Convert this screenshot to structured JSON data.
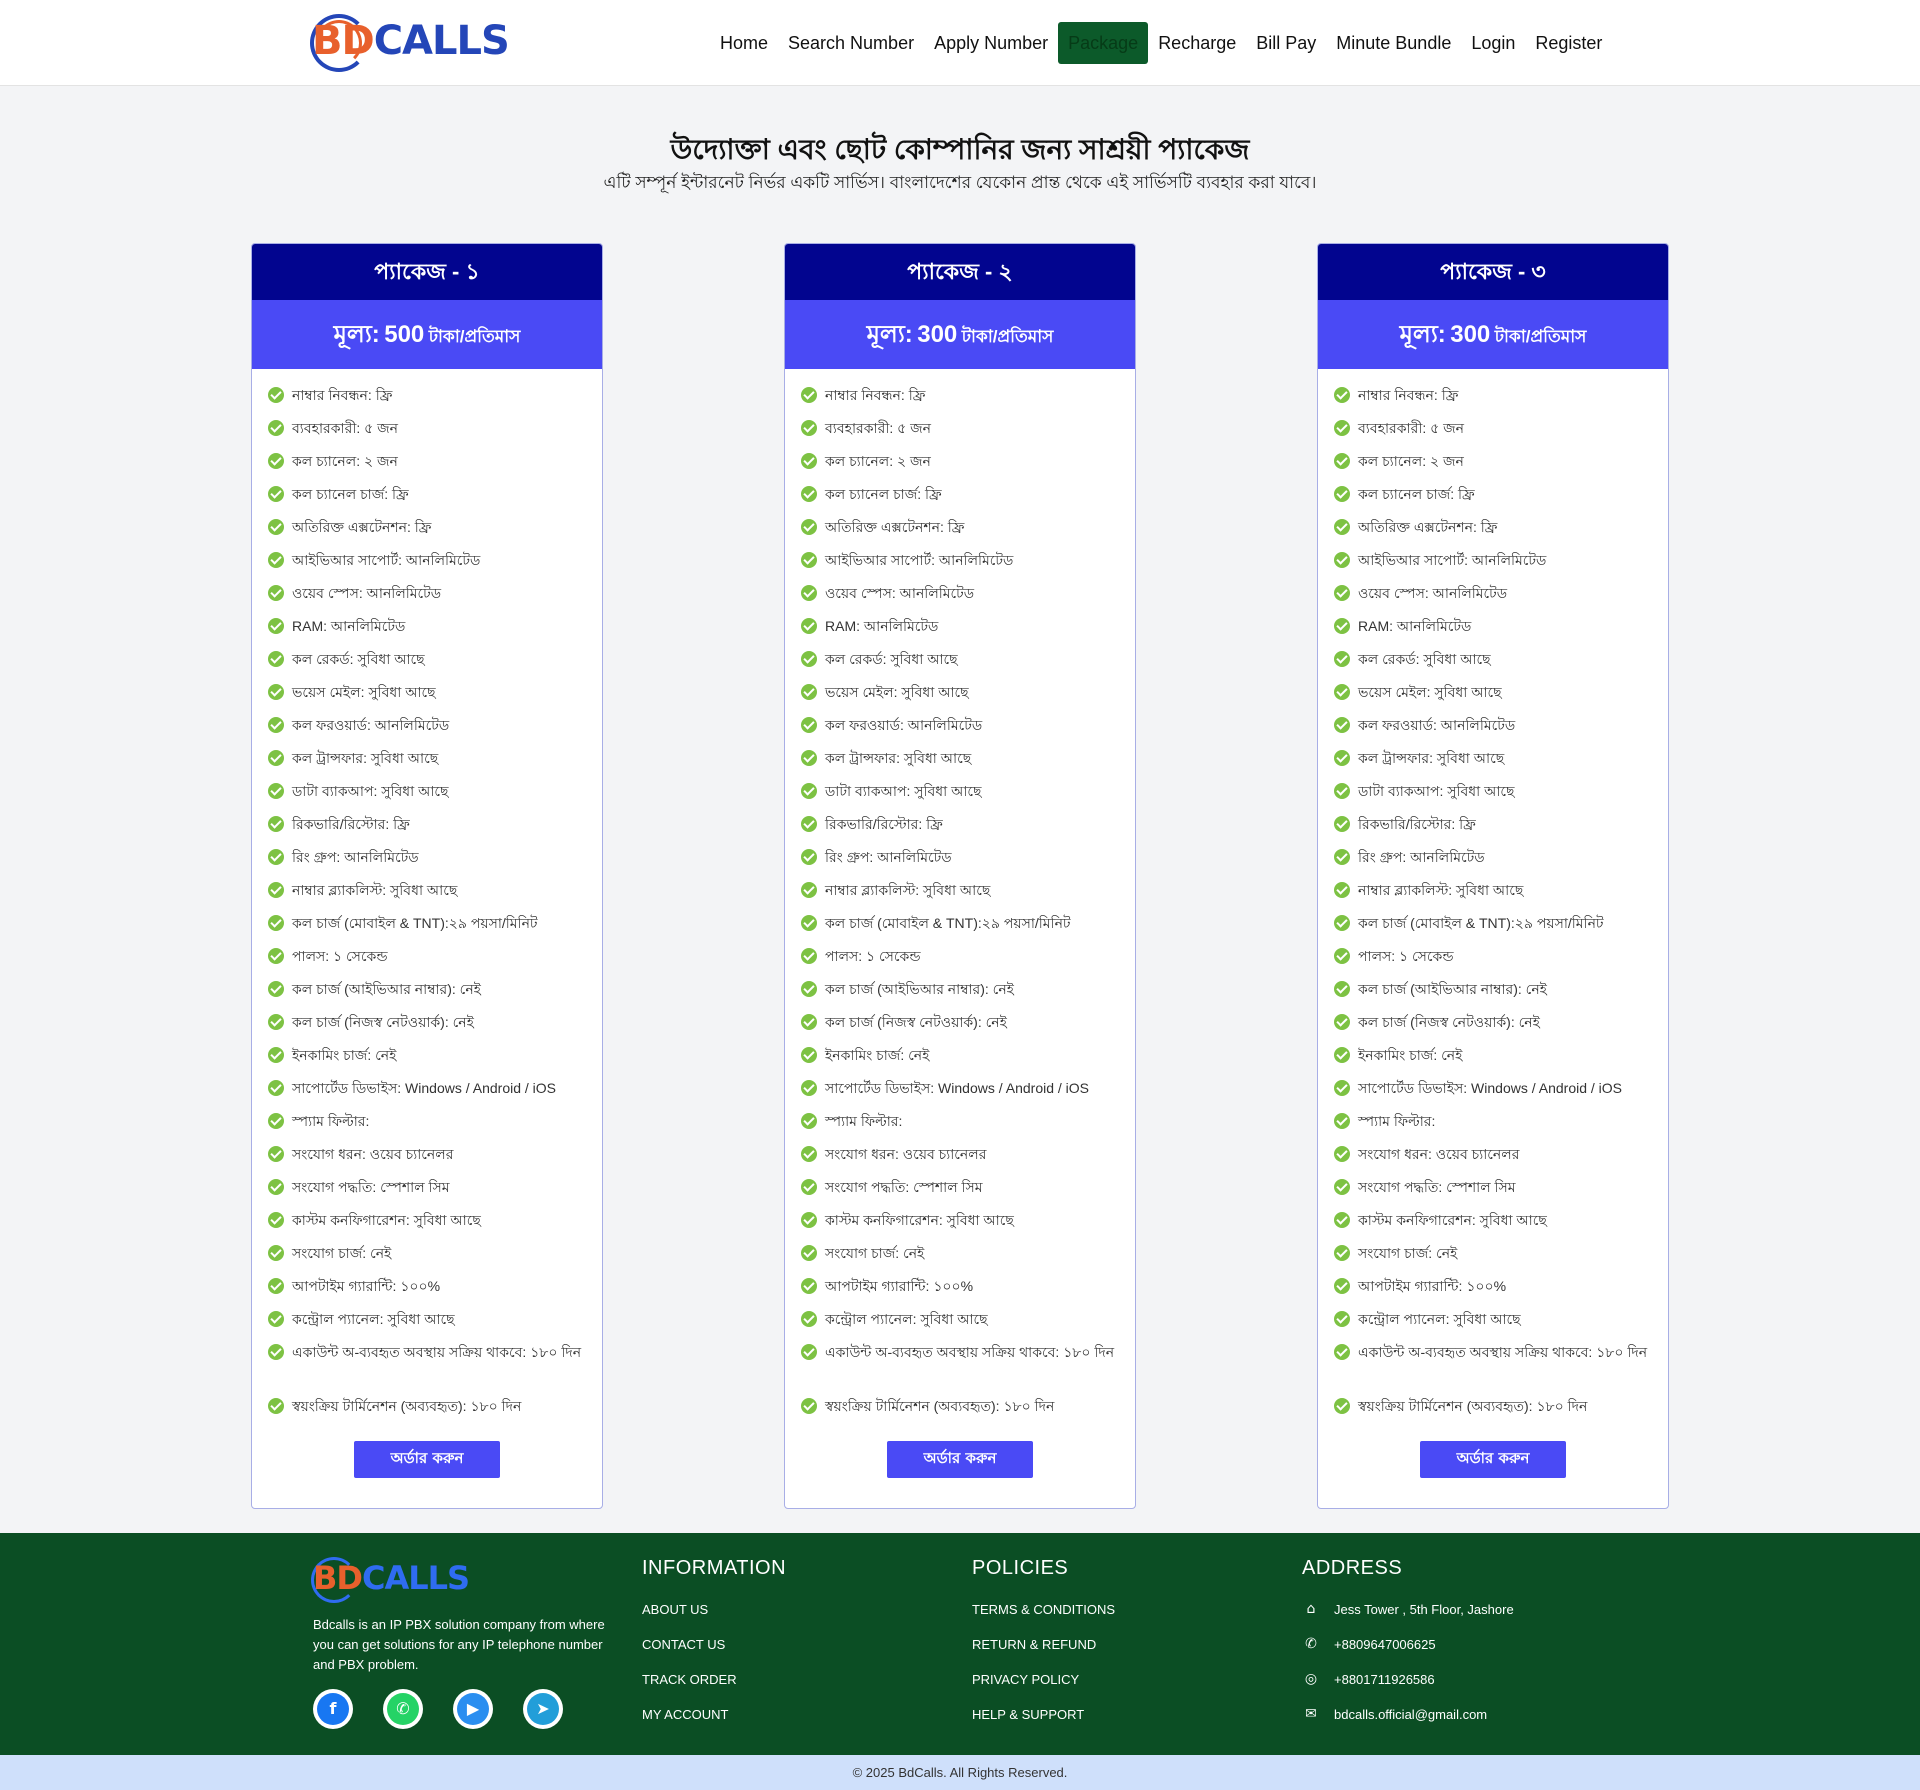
{
  "header": {
    "logo_bd": "BD",
    "logo_calls": "CALLS",
    "nav": [
      {
        "label": "Home",
        "active": false
      },
      {
        "label": "Search Number",
        "active": false
      },
      {
        "label": "Apply Number",
        "active": false
      },
      {
        "label": "Package",
        "active": true
      },
      {
        "label": "Recharge",
        "active": false
      },
      {
        "label": "Bill Pay",
        "active": false
      },
      {
        "label": "Minute Bundle",
        "active": false
      },
      {
        "label": "Login",
        "active": false
      },
      {
        "label": "Register",
        "active": false
      }
    ]
  },
  "hero": {
    "title": "উদ্যোক্তা এবং ছোট কোম্পানির জন্য সাশ্রয়ী প্যাকেজ",
    "subtitle": "এটি সম্পূর্ন ইন্টারনেট নির্ভর একটি সার্ভিস। বাংলাদেশের যেকোন প্রান্ত থেকে এই সার্ভিসটি ব্যবহার করা যাবে।"
  },
  "packages": [
    {
      "name": "প্যাকেজ - ১",
      "price_label": "মূল্য:",
      "price": "500",
      "unit": "টাকা/প্রতিমাস",
      "order_label": "অর্ডার করুন"
    },
    {
      "name": "প্যাকেজ - ২",
      "price_label": "মূল্য:",
      "price": "300",
      "unit": "টাকা/প্রতিমাস",
      "order_label": "অর্ডার করুন"
    },
    {
      "name": "প্যাকেজ - ৩",
      "price_label": "মূল্য:",
      "price": "300",
      "unit": "টাকা/প্রতিমাস",
      "order_label": "অর্ডার করুন"
    }
  ],
  "features": [
    "নাম্বার নিবন্ধন: ফ্রি",
    "ব্যবহারকারী: ৫ জন",
    "কল চ্যানেল: ২ জন",
    "কল চ্যানেল চার্জ: ফ্রি",
    "অতিরিক্ত এক্সটেনশন: ফ্রি",
    "আইভিআর সাপোর্ট: আনলিমিটেড",
    "ওয়েব স্পেস: আনলিমিটেড",
    "RAM: আনলিমিটেড",
    "কল রেকর্ড: সুবিধা আছে",
    "ভয়েস মেইল: সুবিধা আছে",
    "কল ফরওয়ার্ড: আনলিমিটেড",
    "কল ট্রান্সফার: সুবিধা আছে",
    "ডাটা ব্যাকআপ: সুবিধা আছে",
    "রিকভারি/রিস্টোর: ফ্রি",
    "রিং গ্রুপ: আনলিমিটেড",
    "নাম্বার ব্ল্যাকলিস্ট: সুবিধা আছে",
    "কল চার্জ (মোবাইল & TNT):২৯ পয়সা/মিনিট",
    "পালস: ১ সেকেন্ড",
    "কল চার্জ (আইভিআর নাম্বার): নেই",
    "কল চার্জ (নিজস্ব নেটওয়ার্ক): নেই",
    "ইনকামিং চার্জ: নেই",
    "সাপোর্টেড ডিভাইস: Windows / Android / iOS",
    "স্প্যাম ফিল্টার:",
    "সংযোগ ধরন: ওয়েব চ্যানেলর",
    "সংযোগ পদ্ধতি: স্পেশাল সিম",
    "কাস্টম কনফিগারেশন: সুবিধা আছে",
    "সংযোগ চার্জ: নেই",
    "আপটাইম গ্যারান্টি: ১০০%",
    "কন্ট্রোল প্যানেল: সুবিধা আছে",
    "একাউন্ট অ-ব্যবহৃত অবস্থায় সক্রিয় থাকবে: ১৮০ দিন",
    "স্বয়ংক্রিয় টার্মিনেশন (অব্যবহৃত): ১৮০ দিন"
  ],
  "footer": {
    "logo_bd": "BD",
    "logo_calls": "CALLS",
    "about": "Bdcalls is an IP PBX solution company from where you can get solutions for any IP telephone number and PBX problem.",
    "socials": [
      {
        "icon": "facebook-icon",
        "glyph": "f",
        "color": "#1877f2"
      },
      {
        "icon": "whatsapp-icon",
        "glyph": "✆",
        "color": "#25d366"
      },
      {
        "icon": "youtube-icon",
        "glyph": "▶",
        "color": "#2a8ef0"
      },
      {
        "icon": "telegram-icon",
        "glyph": "➤",
        "color": "#229ed9"
      }
    ],
    "information": {
      "title": "INFORMATION",
      "links": [
        "ABOUT US",
        "CONTACT US",
        "TRACK ORDER",
        "MY ACCOUNT"
      ]
    },
    "policies": {
      "title": "POLICIES",
      "links": [
        "TERMS & CONDITIONS",
        "RETURN & REFUND",
        "PRIVACY POLICY",
        "HELP & SUPPORT"
      ]
    },
    "address": {
      "title": "ADDRESS",
      "rows": [
        {
          "icon": "home-icon",
          "glyph": "⌂",
          "text": "Jess Tower , 5th Floor, Jashore"
        },
        {
          "icon": "phone-icon",
          "glyph": "✆",
          "text": "+8809647006625"
        },
        {
          "icon": "whatsapp-icon",
          "glyph": "◎",
          "text": "+8801711926586"
        },
        {
          "icon": "email-icon",
          "glyph": "✉",
          "text": "bdcalls.official@gmail.com"
        }
      ]
    }
  },
  "copyright": "© 2025 BdCalls. All Rights Reserved."
}
